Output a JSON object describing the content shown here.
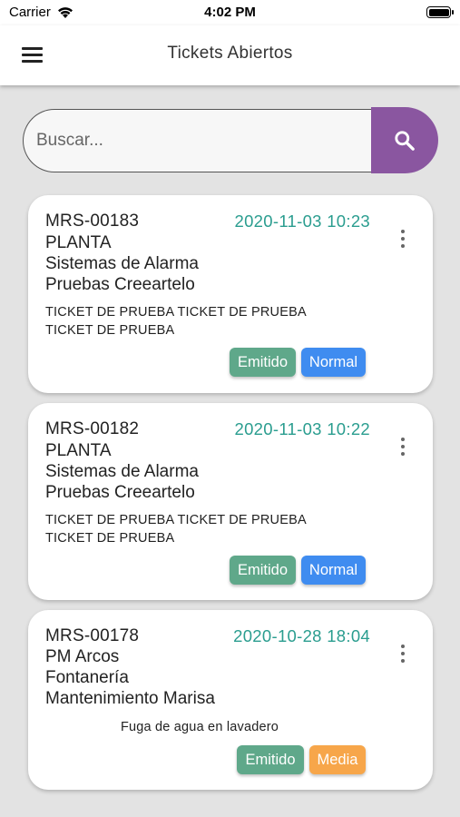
{
  "status_bar": {
    "carrier": "Carrier",
    "time": "4:02 PM"
  },
  "app_bar": {
    "title": "Tickets Abiertos"
  },
  "search": {
    "placeholder": "Buscar..."
  },
  "colors": {
    "accent": "#8a56a0",
    "date": "#2a9d8f",
    "status_emitido": "#5fa88a",
    "priority_normal": "#3f8cf0",
    "priority_media": "#f7a64a"
  },
  "tickets": [
    {
      "code": "MRS-00183",
      "datetime": "2020-11-03 10:23",
      "location": "PLANTA",
      "category": "Sistemas de Alarma",
      "title": "Pruebas Creeartelo",
      "description_line1": "TICKET DE PRUEBA TICKET DE PRUEBA",
      "description_line2": "TICKET DE PRUEBA",
      "status": "Emitido",
      "priority": "Normal"
    },
    {
      "code": "MRS-00182",
      "datetime": "2020-11-03 10:22",
      "location": "PLANTA",
      "category": "Sistemas de Alarma",
      "title": "Pruebas Creeartelo",
      "description_line1": "TICKET DE PRUEBA TICKET DE PRUEBA",
      "description_line2": "TICKET DE PRUEBA",
      "status": "Emitido",
      "priority": "Normal"
    },
    {
      "code": "MRS-00178",
      "datetime": "2020-10-28 18:04",
      "location": "PM Arcos",
      "category": "Fontanería",
      "title": "Mantenimiento Marisa",
      "description_line1": "Fuga de agua en lavadero",
      "status": "Emitido",
      "priority": "Media"
    }
  ]
}
